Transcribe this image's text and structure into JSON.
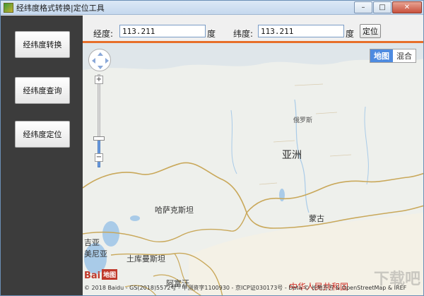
{
  "window": {
    "title": "经纬度格式转换|定位工具",
    "controls": {
      "minimize": "–",
      "maximize": "□",
      "close": "✕"
    }
  },
  "sidebar": {
    "items": [
      {
        "label": "经纬度转换"
      },
      {
        "label": "经纬度查询"
      },
      {
        "label": "经纬度定位"
      }
    ]
  },
  "toolbar": {
    "lon_label": "经度:",
    "lon_value": "113.211",
    "lon_unit": "度",
    "lat_label": "纬度:",
    "lat_value": "113.211",
    "lat_unit": "度",
    "locate_button": "定位"
  },
  "map": {
    "type_buttons": {
      "map": "地图",
      "hybrid": "混合",
      "active": "map"
    },
    "zoom": {
      "plus": "+",
      "minus": "−",
      "level_fraction": 0.3
    },
    "labels": {
      "russia": "俄罗斯",
      "asia": "亚洲",
      "kazakhstan": "哈萨克斯坦",
      "mongolia": "蒙古",
      "kyrgyzstan": "吉亚",
      "armenia_frag": "美尼亚",
      "turkmenistan": "土库曼斯坦",
      "afghanistan": "阿富汗",
      "china": "中华人民共和国"
    },
    "logo": {
      "text": "Bai",
      "badge": "地图"
    },
    "copyright": "© 2018 Baidu - GS(2018)5572号 - 甲测资字1100930 - 京ICP证030173号 - Data © 长地万方 & OpenStreetMap & IREF",
    "watermark": "下载吧"
  },
  "colors": {
    "sidebar_bg": "#3c3c3c",
    "accent_rule": "#e76f2a",
    "map_land": "#eef0ec",
    "border": "#c9a85a",
    "water": "#a9cbe8",
    "active_maptype": "#4e8be0"
  }
}
